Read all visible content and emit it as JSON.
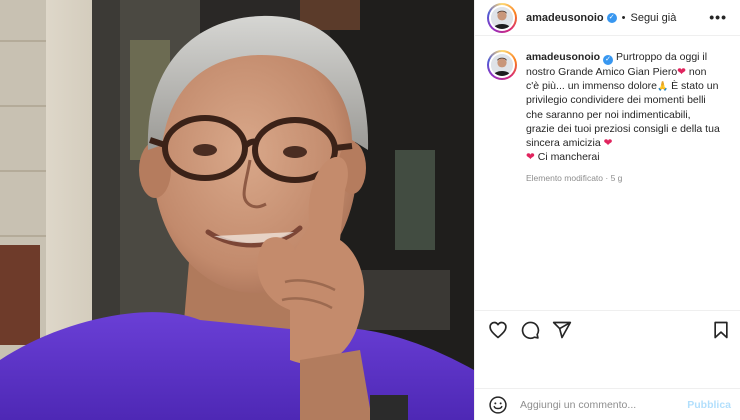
{
  "post": {
    "username": "amadeusonoio",
    "verified": true,
    "follow_separator": "•",
    "follow_label": "Segui già",
    "more_icon": "more-horizontal-icon"
  },
  "caption": {
    "username": "amadeusonoio",
    "segments": [
      " Purtroppo da oggi il nostro Grande Amico Gian Piero",
      " non c'è più... un immenso dolore",
      " È stato un privilegio condividere dei momenti belli che saranno per noi indimenticabili, grazie dei tuoi preziosi consigli e della tua sincera amicizia ",
      " Ci mancherai"
    ],
    "emojis": [
      "red-heart-emoji",
      "folded-hands-emoji",
      "red-heart-emoji",
      "red-heart-emoji"
    ],
    "meta": "Elemento modificato · 5 g"
  },
  "actions": {
    "icons": [
      "heart-icon",
      "comment-icon",
      "share-icon",
      "bookmark-icon"
    ]
  },
  "comment_box": {
    "placeholder": "Aggiungi un commento...",
    "publish_label": "Pubblica",
    "publish_color": "#b2dffc"
  }
}
